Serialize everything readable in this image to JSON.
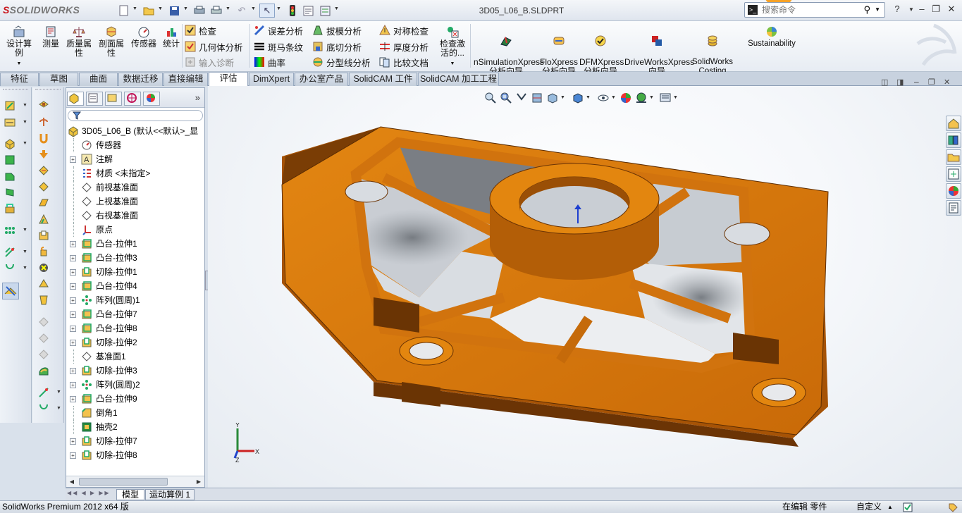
{
  "app": {
    "brand_prefix": "S",
    "brand": "SOLIDWORKS"
  },
  "window": {
    "doc_title": "3D05_L06_B.SLDPRT"
  },
  "search": {
    "placeholder": "搜索命令"
  },
  "ribbon": {
    "design_study": "设计算例",
    "measure": "测量",
    "mass_props": "质量属性",
    "section_props": "剖面属性",
    "sensor": "传感器",
    "statistics": "统计",
    "check": "检查",
    "geometry_analysis": "几何体分析",
    "import_diagnostics": "输入诊断",
    "deviation_analysis": "误差分析",
    "zebra_stripes": "斑马条纹",
    "curvature": "曲率",
    "draft_analysis": "拔模分析",
    "undercut_analysis": "底切分析",
    "parting_line_analysis": "分型线分析",
    "symmetry_check": "对称检查",
    "thickness_analysis": "厚度分析",
    "compare_documents": "比较文档",
    "check_active": "检查激活的...",
    "simulation_xpress": "nSimulationXpress\n分析向导",
    "flo_xpress": "FloXpress\n分析向导",
    "dfm_xpress": "DFMXpress\n分析向导",
    "driveworks_xpress": "DriveWorksXpress\n向导",
    "costing": "SolidWorks\nCosting",
    "sustainability": "Sustainability"
  },
  "tabs": [
    "特征",
    "草图",
    "曲面",
    "数据迁移",
    "直接编辑",
    "评估",
    "DimXpert",
    "办公室产品",
    "SolidCAM 工件",
    "SolidCAM 加工工程"
  ],
  "active_tab": "评估",
  "feature_tree": {
    "root": "3D05_L06_B (默认<<默认>_显",
    "items": [
      {
        "label": "传感器",
        "expand": false,
        "icon": "sensor-icon"
      },
      {
        "label": "注解",
        "expand": true,
        "icon": "annotation-icon"
      },
      {
        "label": "材质 <未指定>",
        "expand": false,
        "icon": "material-icon"
      },
      {
        "label": "前视基准面",
        "expand": false,
        "icon": "plane-icon"
      },
      {
        "label": "上视基准面",
        "expand": false,
        "icon": "plane-icon"
      },
      {
        "label": "右视基准面",
        "expand": false,
        "icon": "plane-icon"
      },
      {
        "label": "原点",
        "expand": false,
        "icon": "origin-icon"
      },
      {
        "label": "凸台-拉伸1",
        "expand": true,
        "icon": "extrude-boss-icon"
      },
      {
        "label": "凸台-拉伸3",
        "expand": true,
        "icon": "extrude-boss-icon"
      },
      {
        "label": "切除-拉伸1",
        "expand": true,
        "icon": "extrude-cut-icon"
      },
      {
        "label": "凸台-拉伸4",
        "expand": true,
        "icon": "extrude-boss-icon"
      },
      {
        "label": "阵列(圆周)1",
        "expand": true,
        "icon": "circular-pattern-icon"
      },
      {
        "label": "凸台-拉伸7",
        "expand": true,
        "icon": "extrude-boss-icon"
      },
      {
        "label": "凸台-拉伸8",
        "expand": true,
        "icon": "extrude-boss-icon"
      },
      {
        "label": "切除-拉伸2",
        "expand": true,
        "icon": "extrude-cut-icon"
      },
      {
        "label": "基准面1",
        "expand": false,
        "icon": "plane-icon"
      },
      {
        "label": "切除-拉伸3",
        "expand": true,
        "icon": "extrude-cut-icon"
      },
      {
        "label": "阵列(圆周)2",
        "expand": true,
        "icon": "circular-pattern-icon"
      },
      {
        "label": "凸台-拉伸9",
        "expand": true,
        "icon": "extrude-boss-icon"
      },
      {
        "label": "倒角1",
        "expand": false,
        "icon": "chamfer-icon"
      },
      {
        "label": "抽壳2",
        "expand": false,
        "icon": "shell-icon"
      },
      {
        "label": "切除-拉伸7",
        "expand": true,
        "icon": "extrude-cut-icon"
      },
      {
        "label": "切除-拉伸8",
        "expand": true,
        "icon": "extrude-cut-icon"
      }
    ]
  },
  "bottom_tabs": [
    "模型",
    "运动算例 1"
  ],
  "status": {
    "product": "SolidWorks Premium 2012 x64 版",
    "mode": "在编辑 零件",
    "units": "自定义"
  },
  "triad": {
    "x": "X",
    "y": "Y",
    "z": "Z"
  },
  "colors": {
    "part": "#d1730e",
    "accent": "#c9141b"
  }
}
